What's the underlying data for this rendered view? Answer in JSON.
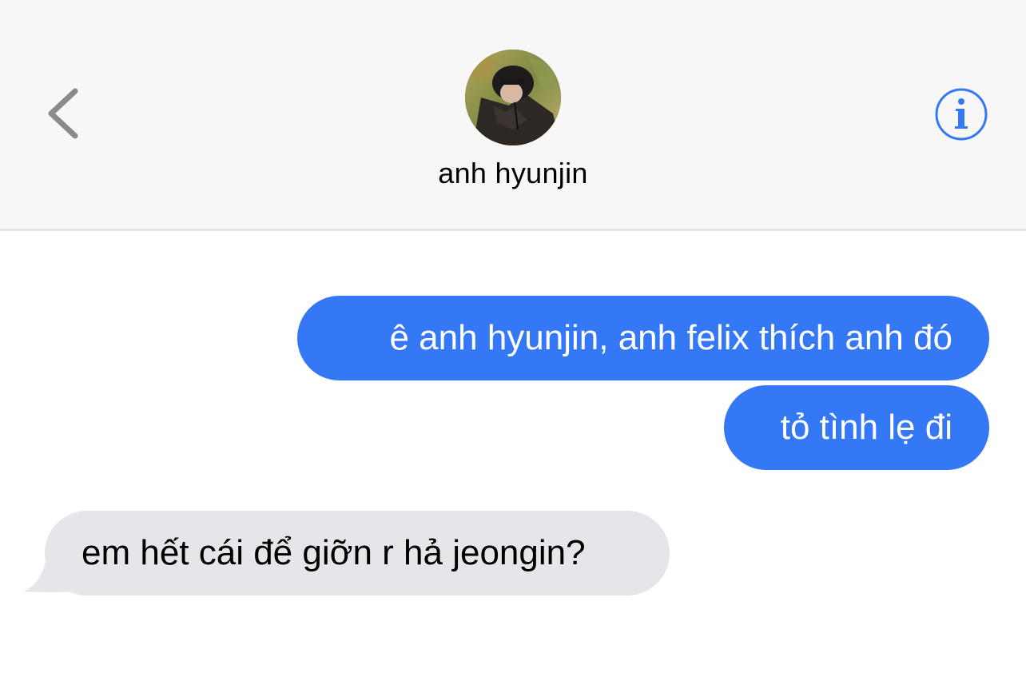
{
  "header": {
    "contact_name": "anh hyunjin",
    "back_icon": "chevron-left-icon",
    "info_icon": "info-icon",
    "accent_color": "#3478f6"
  },
  "messages": [
    {
      "direction": "sent",
      "text": "ê anh hyunjin, anh felix thích anh đó"
    },
    {
      "direction": "sent",
      "text": "tỏ tình lẹ đi"
    },
    {
      "direction": "received",
      "text": "em hết cái để giỡn r hả jeongin?"
    }
  ],
  "colors": {
    "sent_bubble": "#3478f6",
    "received_bubble": "#e5e5ea",
    "header_background": "#f7f7f7"
  }
}
